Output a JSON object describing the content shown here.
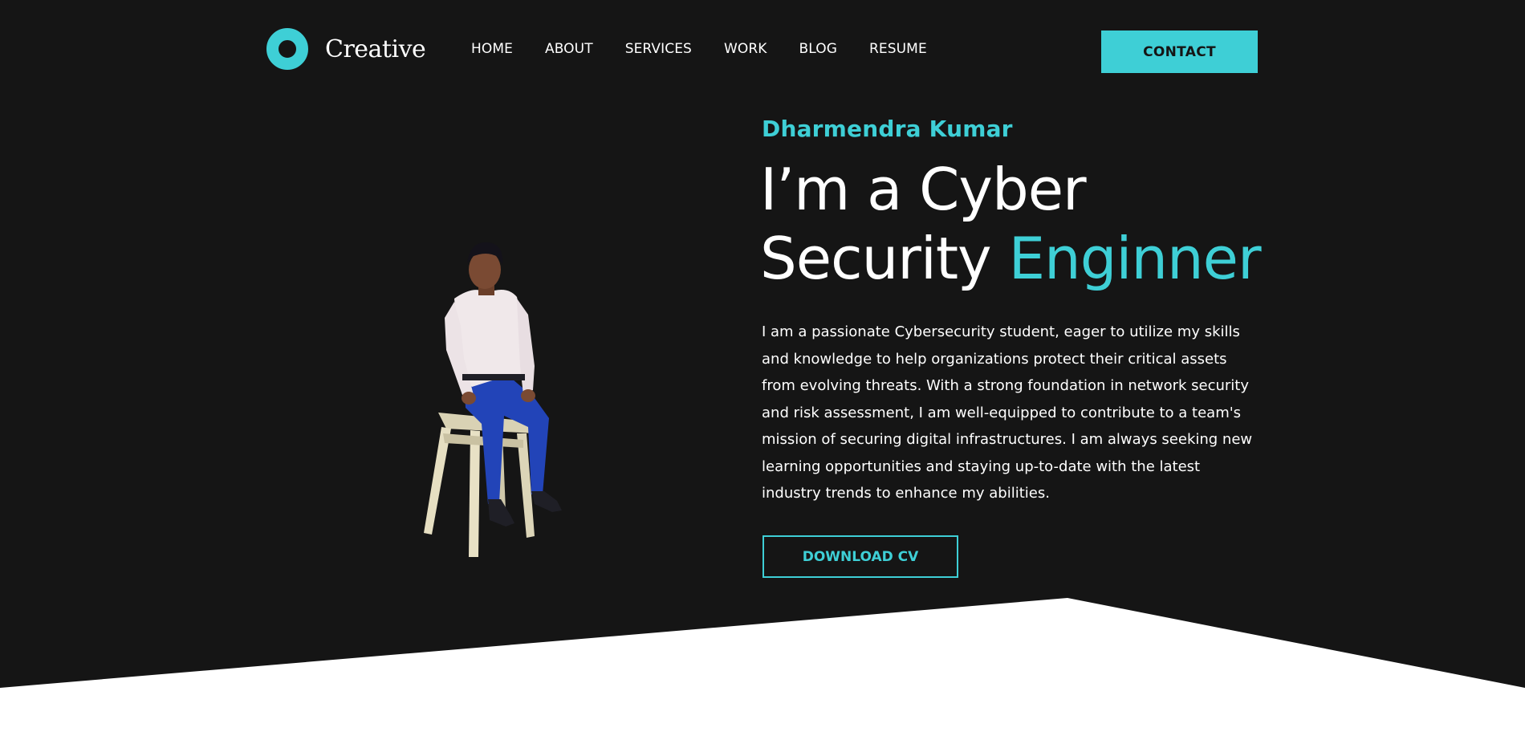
{
  "colors": {
    "background": "#151515",
    "accent": "#3ecfd6",
    "text": "#ffffff",
    "lower_section": "#ffffff"
  },
  "logo": {
    "icon": "ring-logo-icon",
    "text": "Creative"
  },
  "nav": {
    "items": [
      {
        "label": "HOME"
      },
      {
        "label": "ABOUT"
      },
      {
        "label": "SERVICES"
      },
      {
        "label": "WORK"
      },
      {
        "label": "BLOG"
      },
      {
        "label": "RESUME"
      }
    ]
  },
  "header": {
    "contact_label": "CONTACT"
  },
  "hero": {
    "name": "Dharmendra Kumar",
    "title_line1": "I’m a Cyber",
    "title_line2_plain": "Security",
    "title_line2_accent": "Enginner",
    "description": "I am a passionate Cybersecurity student, eager to utilize my skills and knowledge to help organizations protect their critical assets from evolving threats. With a strong foundation in network security and risk assessment, I am well-equipped to contribute to a team's mission of securing digital infrastructures. I am always seeking new learning opportunities and staying up-to-date with the latest industry trends to enhance my abilities.",
    "download_label": "DOWNLOAD CV",
    "portrait": "person-seated-on-stool-photo"
  }
}
